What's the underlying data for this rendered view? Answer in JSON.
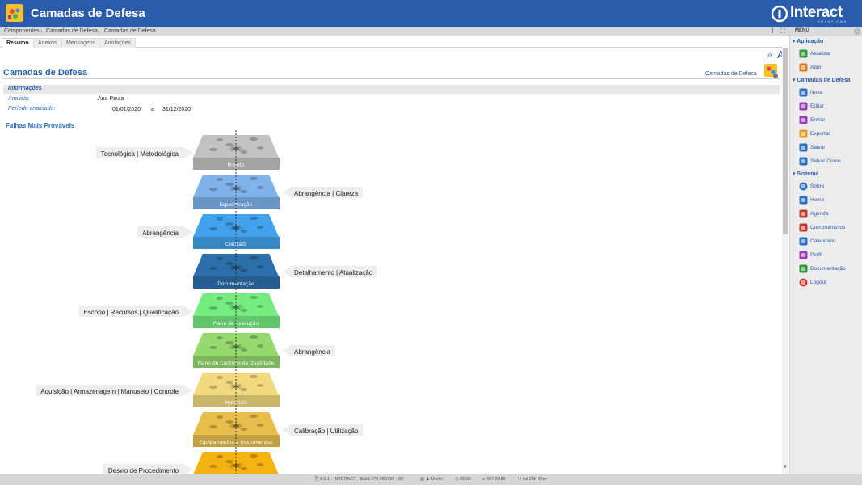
{
  "header": {
    "title": "Camadas de Defesa",
    "brand": "Interact",
    "brand_sub": "SOLUTIONS"
  },
  "breadcrumb": [
    "Componentes",
    "Camadas de Defesa",
    "Camadas de Defesa"
  ],
  "tabs": [
    "Resumo",
    "Anexos",
    "Mensagens",
    "Anotações"
  ],
  "main": {
    "page_title": "Camadas de Defesa",
    "context_link": "Camadas de Defesa",
    "info_title": "Informações",
    "analyst_label": "Analista:",
    "analyst_value": "Ana Paula",
    "period_label": "Período analisado:",
    "period_from": "01/01/2020",
    "period_sep": "a",
    "period_to": "31/12/2020",
    "section_title": "Falhas Mais Prováveis"
  },
  "layers": [
    {
      "name": "Projeto",
      "color": "#b9b9b9",
      "callout": "Tecnológica | Metodológica",
      "side": "left"
    },
    {
      "name": "Especificação",
      "color": "#7aaadf",
      "callout": "Abrangência | Clareza",
      "side": "right"
    },
    {
      "name": "Contrato",
      "color": "#3f9ae0",
      "callout": "Abrangência",
      "side": "left"
    },
    {
      "name": "Documentação",
      "color": "#2b6aa3",
      "callout": "Detalhamento | Atualização",
      "side": "right"
    },
    {
      "name": "Plano de Execução",
      "color": "#6fe07a",
      "callout": "Escopo | Recursos | Qualificação",
      "side": "left"
    },
    {
      "name": "Plano de Controle da Qualidade",
      "color": "#8fcf6a",
      "callout": "Abrangência",
      "side": "right"
    },
    {
      "name": "Materiais",
      "color": "#e6cf7a",
      "callout": "Aquisição | Armazenagem | Manuseio | Controle",
      "side": "left"
    },
    {
      "name": "Equipamentos e Instrumentos",
      "color": "#dcb548",
      "callout": "Calibração | Utilização",
      "side": "right"
    },
    {
      "name": "",
      "color": "#e9aa12",
      "callout": "Desvio de Procedimento",
      "side": "left"
    }
  ],
  "menu": {
    "label": "MENU",
    "groups": [
      {
        "title": "Aplicação",
        "items": [
          {
            "label": "Atualizar",
            "icon": "refresh-icon",
            "color": "#2e9a3a"
          },
          {
            "label": "Abrir",
            "icon": "folder-icon",
            "color": "#e07a1e"
          }
        ]
      },
      {
        "title": "Camadas de Defesa",
        "items": [
          {
            "label": "Nova",
            "icon": "plus-icon",
            "color": "#2a6fc2"
          },
          {
            "label": "Editar",
            "icon": "pencil-icon",
            "color": "#9a3fb5"
          },
          {
            "label": "Enviar",
            "icon": "send-icon",
            "color": "#9a3fb5"
          },
          {
            "label": "Exportar",
            "icon": "export-icon",
            "color": "#e0a01e"
          },
          {
            "label": "Salvar",
            "icon": "save-icon",
            "color": "#2a6fc2"
          },
          {
            "label": "Salvar Como",
            "icon": "save-as-icon",
            "color": "#2a6fc2"
          }
        ]
      },
      {
        "title": "Sistema",
        "items": [
          {
            "label": "Sobre",
            "icon": "info-icon",
            "color": "#2a6fc2"
          },
          {
            "label": "Home",
            "icon": "home-icon",
            "color": "#2a6fc2"
          },
          {
            "label": "Agenda",
            "icon": "agenda-icon",
            "color": "#c0392b"
          },
          {
            "label": "Compromissos",
            "icon": "briefcase-icon",
            "color": "#c0392b"
          },
          {
            "label": "Calendário",
            "icon": "calendar-icon",
            "color": "#2a6fc2"
          },
          {
            "label": "Perfil",
            "icon": "key-icon",
            "color": "#9a3fb5"
          },
          {
            "label": "Documentação",
            "icon": "books-icon",
            "color": "#2e9a3a"
          },
          {
            "label": "Logout",
            "icon": "power-icon",
            "color": "#d9342b"
          }
        ]
      }
    ]
  },
  "status": {
    "build": "8.0.1 - INTERACT - Build 274.283732 - 80",
    "user": "Murilo",
    "time": "00:36",
    "memory": "497,3 MB",
    "uptime": "6d 23h 40m"
  }
}
